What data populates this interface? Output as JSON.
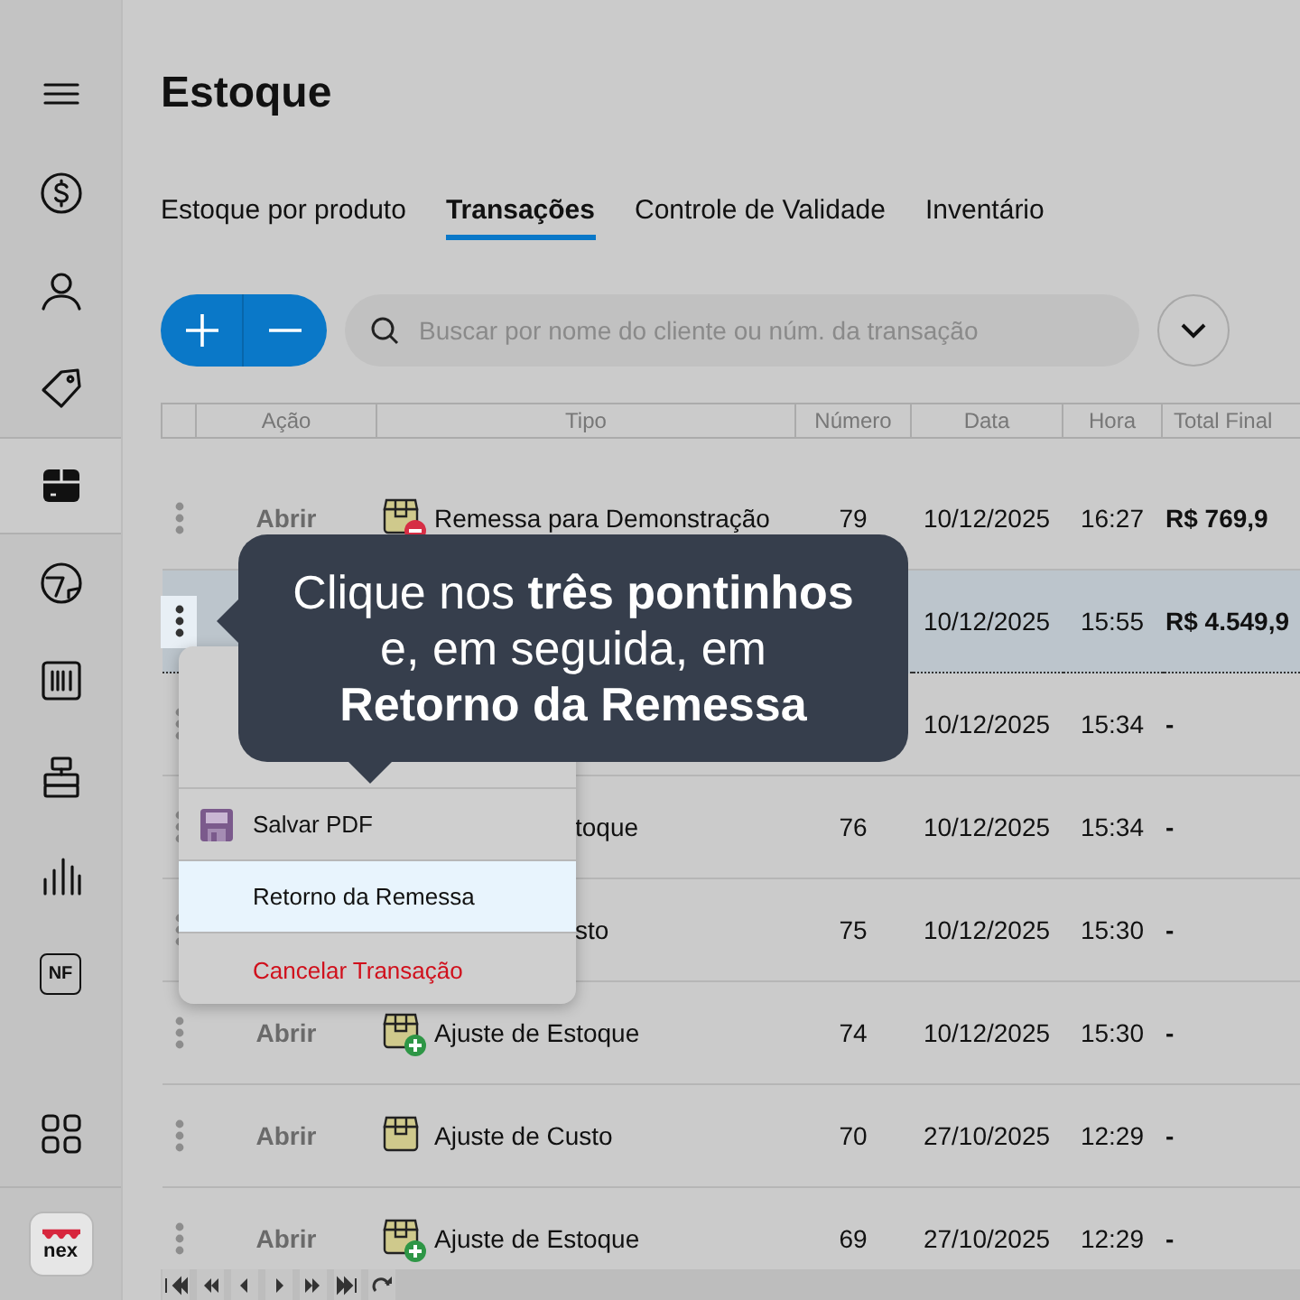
{
  "sidebar": {
    "items": [
      {
        "kind": "dollar",
        "selected": false
      },
      {
        "kind": "user",
        "selected": false
      },
      {
        "kind": "tag",
        "selected": false
      },
      {
        "kind": "box",
        "selected": true
      },
      {
        "kind": "gauge",
        "selected": false
      },
      {
        "kind": "barcode",
        "selected": false
      },
      {
        "kind": "stack",
        "selected": false
      },
      {
        "kind": "chart",
        "selected": false
      },
      {
        "kind": "nf",
        "label": "NF",
        "selected": false
      }
    ],
    "logo": "nex"
  },
  "title": "Estoque",
  "tabs": [
    {
      "label": "Estoque por produto",
      "selected": false
    },
    {
      "label": "Transações",
      "selected": true
    },
    {
      "label": "Controle de Validade",
      "selected": false
    },
    {
      "label": "Inventário",
      "selected": false
    }
  ],
  "search": {
    "placeholder": "Buscar por nome do cliente ou núm. da transação"
  },
  "table": {
    "columns": [
      "Ação",
      "Tipo",
      "Número",
      "Data",
      "Hora",
      "Total Final"
    ],
    "rows": [
      {
        "selected": false,
        "action": "Abrir",
        "type": "Remessa para Demonstração",
        "kind": "removal",
        "number": "79",
        "date": "10/12/2025",
        "time": "16:27",
        "total": "R$ 769,9"
      },
      {
        "selected": true,
        "date": "10/12/2025",
        "time": "15:55",
        "total": "R$ 4.549,9"
      },
      {
        "selected": false,
        "date": "10/12/2025",
        "time": "15:34",
        "total": "-"
      },
      {
        "selected": false,
        "kind": "covered",
        "type": "toque",
        "number": "76",
        "date": "10/12/2025",
        "time": "15:34",
        "total": "-"
      },
      {
        "selected": false,
        "kind": "covered",
        "type": "sto",
        "number": "75",
        "date": "10/12/2025",
        "time": "15:30",
        "total": "-"
      },
      {
        "selected": false,
        "action": "Abrir",
        "type": "Ajuste de Estoque",
        "kind": "addition",
        "number": "74",
        "date": "10/12/2025",
        "time": "15:30",
        "total": "-"
      },
      {
        "selected": false,
        "action": "Abrir",
        "type": "Ajuste de Custo",
        "kind": "plain",
        "number": "70",
        "date": "27/10/2025",
        "time": "12:29",
        "total": "-"
      },
      {
        "selected": false,
        "action": "Abrir",
        "type": "Ajuste de Estoque",
        "kind": "addition",
        "number": "69",
        "date": "27/10/2025",
        "time": "12:29",
        "total": "-"
      }
    ]
  },
  "menu": {
    "items": [
      {
        "label": "Salvar PDF",
        "kind": "save",
        "selected": false
      },
      {
        "label": "Retorno da Remessa",
        "kind": "normal",
        "selected": true
      },
      {
        "label": "Cancelar Transação",
        "kind": "danger",
        "selected": false
      }
    ]
  },
  "tooltip": {
    "lines": [
      "Clique nos **três pontinhos**",
      "e, em seguida, em",
      "**Retorno da Remessa**"
    ]
  }
}
